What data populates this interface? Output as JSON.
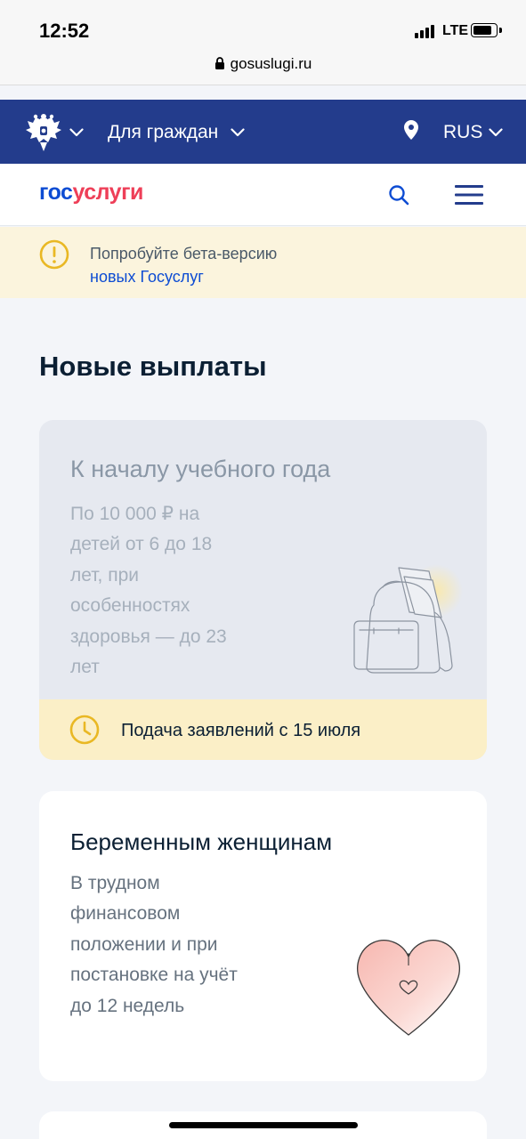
{
  "status_bar": {
    "time": "12:52",
    "network": "LTE",
    "signal_bars": 4,
    "battery_level": 0.8
  },
  "browser": {
    "url": "gosuslugi.ru",
    "lock_icon": "lock-icon"
  },
  "top_nav": {
    "emblem_icon": "coat-of-arms-icon",
    "audience_label": "Для граждан",
    "location_icon": "map-pin-icon",
    "language": "RUS"
  },
  "header": {
    "logo_part1": "гос",
    "logo_part2": "услуги",
    "search_icon": "search-icon",
    "menu_icon": "menu-icon"
  },
  "beta_banner": {
    "text": "Попробуйте бета-версию",
    "link": "новых Госуслуг"
  },
  "section": {
    "title": "Новые выплаты"
  },
  "cards": [
    {
      "title": "К началу учебного года",
      "description": "По 10 000 ₽ на детей от 6 до 18 лет, при особенностях здоровья — до 23 лет",
      "illustration": "backpack-icon",
      "deadline": "Подача заявлений с 15 июля"
    },
    {
      "title": "Беременным женщинам",
      "description": "В трудном финансовом положении и при постановке на учёт до 12 недель",
      "illustration": "heart-icon"
    }
  ],
  "colors": {
    "nav_blue": "#233c8c",
    "brand_blue": "#0d4cd3",
    "brand_red": "#ee3f58",
    "warning_yellow": "#e9b824",
    "banner_bg": "#fbf4dd"
  }
}
